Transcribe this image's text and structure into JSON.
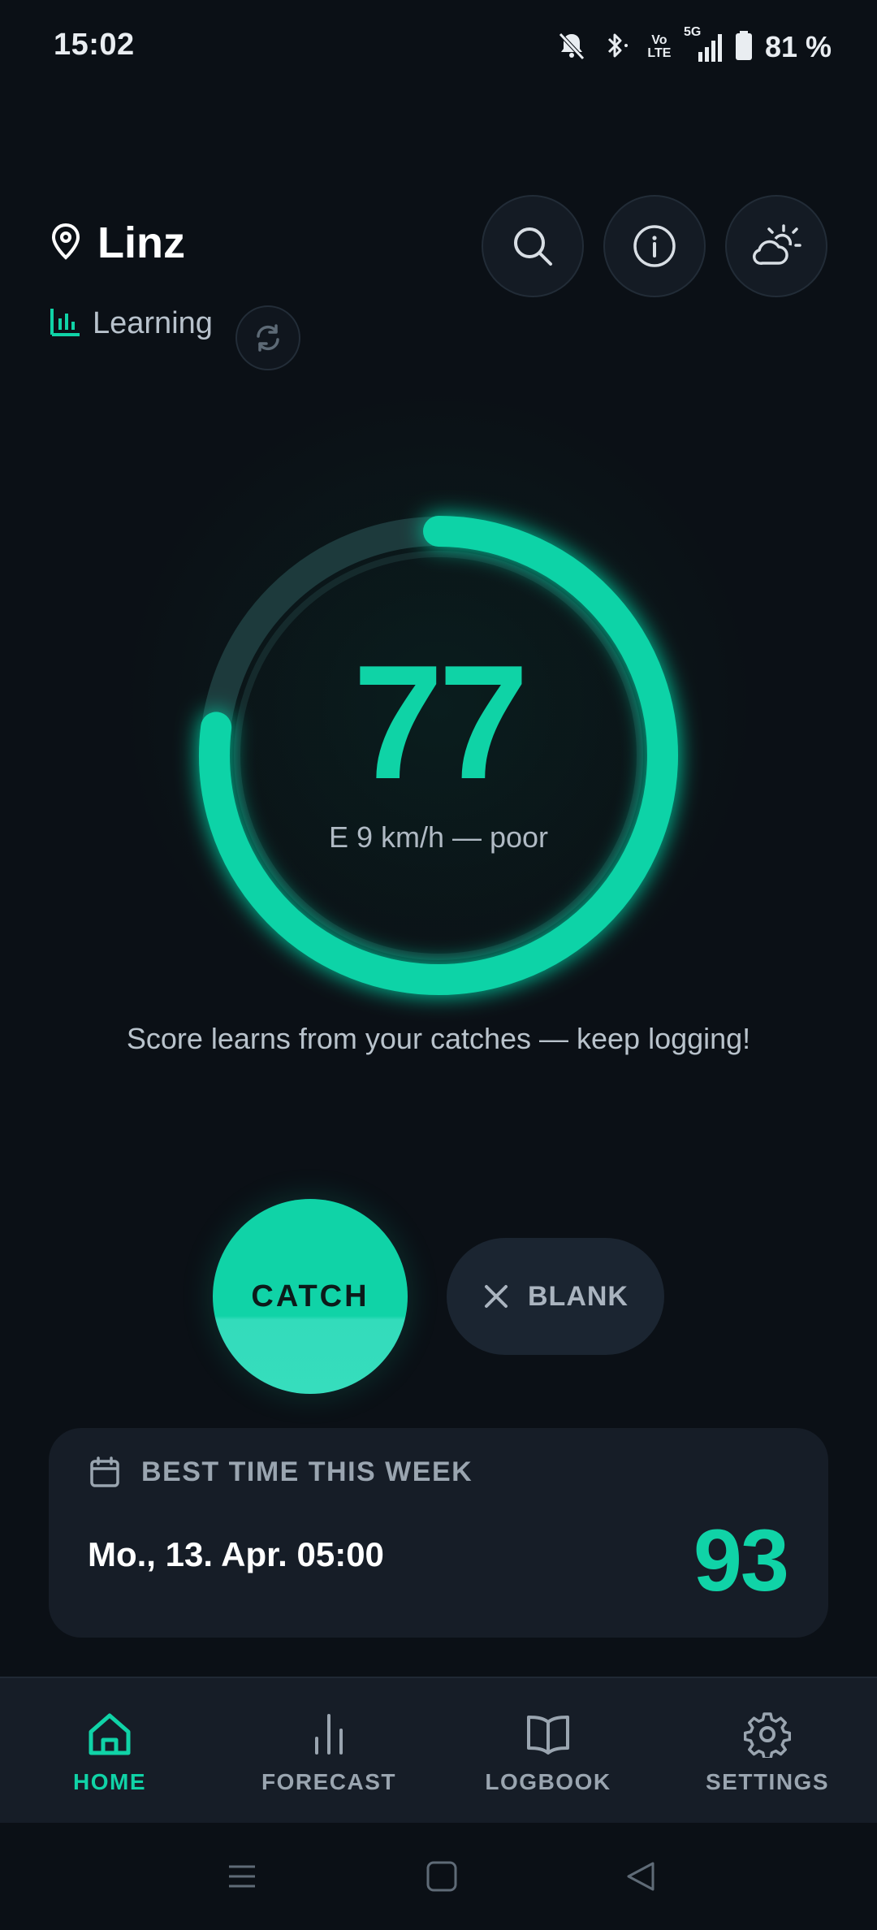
{
  "status_bar": {
    "time": "15:02",
    "volte_label": "Vo LTE",
    "network_label": "5G",
    "battery": "81 %"
  },
  "header": {
    "location": "Linz",
    "mode_label": "Learning"
  },
  "gauge": {
    "score": "77",
    "score_fraction": 0.77,
    "conditions": "E 9 km/h — poor",
    "hint": "Score learns from your catches — keep logging!"
  },
  "actions": {
    "catch_label": "CATCH",
    "blank_label": "BLANK"
  },
  "best_time": {
    "title": "BEST TIME THIS WEEK",
    "datetime": "Mo., 13. Apr. 05:00",
    "score": "93"
  },
  "nav": {
    "items": [
      {
        "label": "HOME",
        "icon": "home-icon",
        "active": true
      },
      {
        "label": "FORECAST",
        "icon": "bar-chart-icon",
        "active": false
      },
      {
        "label": "LOGBOOK",
        "icon": "book-icon",
        "active": false
      },
      {
        "label": "SETTINGS",
        "icon": "gear-icon",
        "active": false
      }
    ]
  },
  "colors": {
    "accent": "#10d3a7",
    "background": "#0b1016",
    "card": "#161d27"
  }
}
